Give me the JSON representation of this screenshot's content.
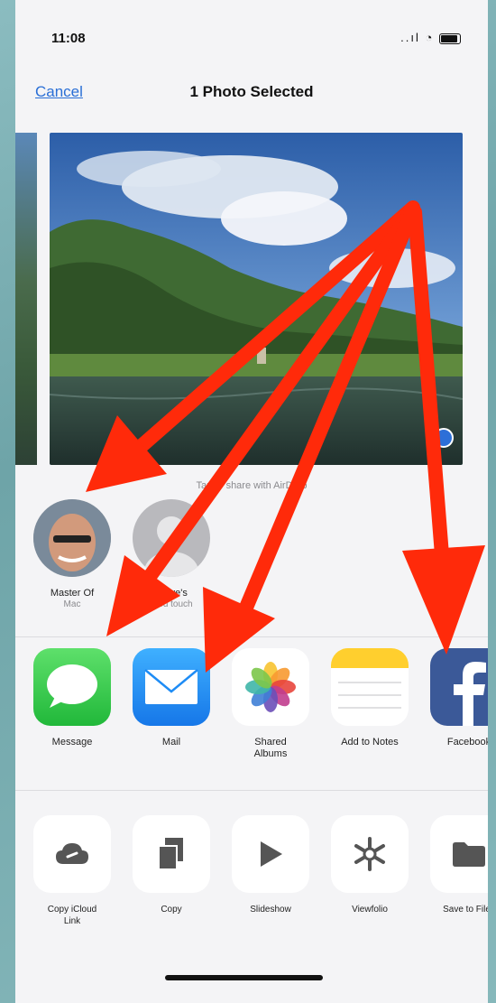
{
  "status": {
    "time": "11:08",
    "signal": "..ıl"
  },
  "nav": {
    "cancel": "Cancel",
    "title": "1 Photo Selected"
  },
  "airdrop_hint": "Tap to share with AirDrop",
  "people": [
    {
      "name": "Master Of",
      "sub": "Mac"
    },
    {
      "name": "Steve's",
      "sub": "iPod touch"
    }
  ],
  "apps": [
    {
      "label": "Message",
      "icon": "messages-icon",
      "color": "#34c759"
    },
    {
      "label": "Mail",
      "icon": "mail-icon",
      "color": "#1e8cf5"
    },
    {
      "label": "Shared\nAlbums",
      "icon": "photos-icon",
      "color": "#ffffff"
    },
    {
      "label": "Add to Notes",
      "icon": "notes-icon",
      "color": "#ffffff"
    },
    {
      "label": "Facebook",
      "icon": "facebook-icon",
      "color": "#3b5998"
    }
  ],
  "actions": [
    {
      "label": "Copy iCloud\nLink",
      "icon": "cloud-link-icon"
    },
    {
      "label": "Copy",
      "icon": "copy-icon"
    },
    {
      "label": "Slideshow",
      "icon": "play-icon"
    },
    {
      "label": "Viewfolio",
      "icon": "snowflake-icon"
    },
    {
      "label": "Save to Files",
      "icon": "folder-icon"
    }
  ],
  "annotation_color": "#ff2a0a"
}
